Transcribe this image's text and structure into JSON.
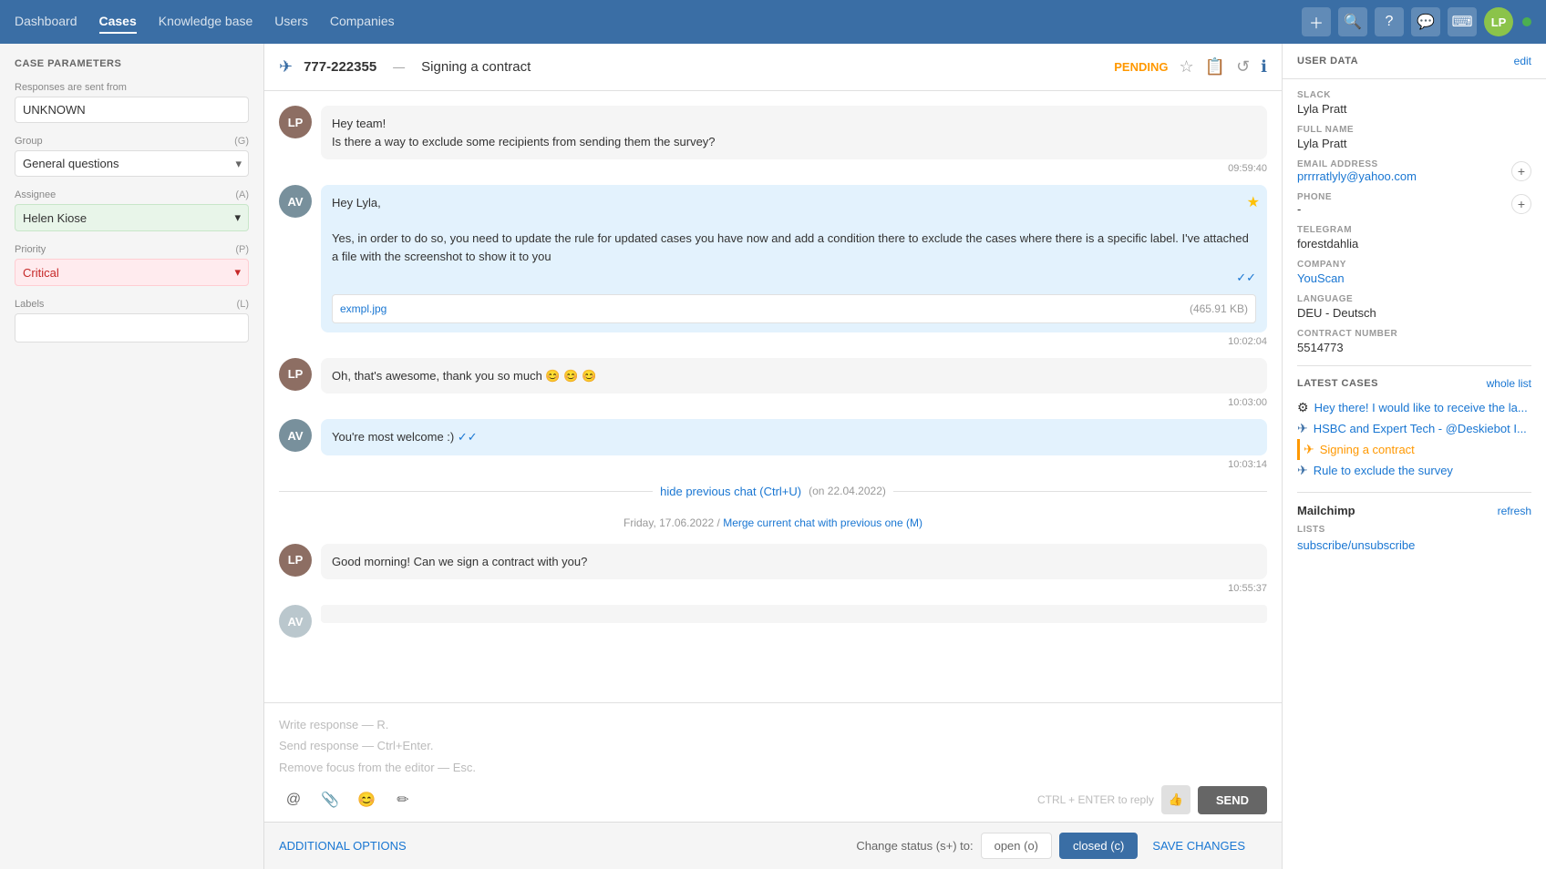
{
  "nav": {
    "items": [
      "Dashboard",
      "Cases",
      "Knowledge base",
      "Users",
      "Companies"
    ],
    "active": "Cases"
  },
  "case": {
    "number": "777-222355",
    "title": "Signing a contract",
    "status": "PENDING"
  },
  "sidebar": {
    "title": "CASE PARAMETERS",
    "responses_from_label": "Responses are sent from",
    "responses_from_value": "UNKNOWN",
    "group_label": "Group",
    "group_shortcut": "(G)",
    "group_value": "General questions",
    "assignee_label": "Assignee",
    "assignee_shortcut": "(A)",
    "assignee_value": "Helen Kiose",
    "priority_label": "Priority",
    "priority_shortcut": "(P)",
    "priority_value": "Critical",
    "labels_label": "Labels",
    "labels_shortcut": "(L)"
  },
  "messages": [
    {
      "id": 1,
      "from": "user",
      "text": "Hey team!\nIs there a way to exclude some recipients from sending them the survey?",
      "time": "09:59:40",
      "avatar": "LP"
    },
    {
      "id": 2,
      "from": "agent",
      "text": "Hey Lyla,\n\nYes, in order to do so, you need to update the rule for updated cases you have now and add a condition there to exclude the cases where there is a specific label. I've attached a file with the screenshot to show it to you",
      "time": "10:02:04",
      "starred": true,
      "attachment": {
        "name": "exmpl.jpg",
        "size": "(465.91 KB)"
      },
      "avatar": "AV"
    },
    {
      "id": 3,
      "from": "user",
      "text": "Oh, that's awesome, thank you so much 😊 😊 😊",
      "time": "10:03:00",
      "avatar": "LP"
    },
    {
      "id": 4,
      "from": "agent",
      "text": "You're most welcome :) ✓✓",
      "time": "10:03:14",
      "avatar": "AV"
    }
  ],
  "hide_chat": {
    "text": "hide previous chat (Ctrl+U)",
    "date_note": "(on 22.04.2022)"
  },
  "date_separator": "Friday, 17.06.2022 / Merge current chat with previous one (M)",
  "recent_message": {
    "text": "Good morning! Can we sign a contract with you?",
    "time": "10:55:37",
    "avatar": "LP"
  },
  "response": {
    "placeholder1": "Write response — R.",
    "placeholder2": "Send response — Ctrl+Enter.",
    "placeholder3": "Remove focus from the editor — Esc.",
    "ctrl_hint": "CTRL + ENTER to reply",
    "send_label": "SEND"
  },
  "bottom": {
    "additional_options": "ADDITIONAL OPTIONS",
    "change_status": "Change status (s+) to:",
    "open_btn": "open (o)",
    "closed_btn": "closed (c)",
    "save_btn": "SAVE CHANGES"
  },
  "user_data": {
    "title": "USER DATA",
    "edit": "edit",
    "slack_label": "SLACK",
    "slack_value": "Lyla Pratt",
    "full_name_label": "FULL NAME",
    "full_name_value": "Lyla Pratt",
    "email_label": "EMAIL ADDRESS",
    "email_value": "prrrratlyly@yahoo.com",
    "phone_label": "PHONE",
    "phone_value": "-",
    "telegram_label": "TELEGRAM",
    "telegram_value": "forestdahlia",
    "company_label": "COMPANY",
    "company_value": "YouScan",
    "language_label": "LANGUAGE",
    "language_value": "DEU - Deutsch",
    "contract_label": "CONTRACT NUMBER",
    "contract_value": "5514773"
  },
  "latest_cases": {
    "title": "LATEST CASES",
    "whole_list": "whole list",
    "items": [
      {
        "text": "Hey there! I would like to receive the la...",
        "icon": "⚙",
        "type": "gear"
      },
      {
        "text": "HSBC and Expert Tech - @Deskiebot I...",
        "icon": "✈",
        "type": "plane"
      },
      {
        "text": "Signing a contract",
        "icon": "✈",
        "type": "plane",
        "active": true
      },
      {
        "text": "Rule to exclude the survey",
        "icon": "✈",
        "type": "plane"
      }
    ]
  },
  "mailchimp": {
    "title": "Mailchimp",
    "refresh": "refresh",
    "lists_label": "LISTS",
    "lists_value": "subscribe/unsubscribe"
  }
}
